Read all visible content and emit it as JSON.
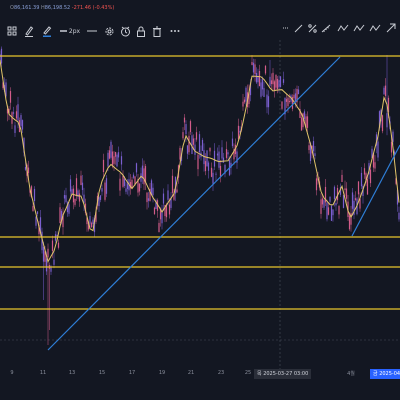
{
  "header": {
    "ohlc_open_label": "O",
    "ohlc_open_value": "86,161.39",
    "ohlc_high_label": "H",
    "ohlc_high_value": "86,198.52",
    "ohlc_change": "-271.46 (-0.43%)"
  },
  "toolbar": {
    "line_width_label": "2px",
    "left_icons": [
      "template-icon",
      "pencil-icon",
      "line-color-icon",
      "line-width-icon",
      "line-style-icon",
      "settings-icon",
      "alert-icon",
      "lock-icon",
      "trash-icon",
      "more-icon"
    ],
    "right_icons": [
      "dashed-line-icon",
      "trend-line-icon",
      "percent-icon",
      "ruler-icon",
      "wave-a-icon",
      "wave-b-icon",
      "wave-c-icon",
      "arrow-up-right-icon"
    ]
  },
  "time_axis": {
    "ticks": [
      "9",
      "11",
      "13",
      "15",
      "17",
      "19",
      "21",
      "23",
      "25",
      "4월"
    ],
    "crosshair_date": "목 2025-03-27  03:00",
    "highlight_date": "금 2025-04"
  },
  "colors": {
    "background": "#131722",
    "horizontal_lines": "#e8c62c",
    "trend_lines": "#2f7fd8",
    "moving_average": "#e2c56a",
    "candles": "#7b5fd0",
    "candles_alt": "#d35c8a"
  }
}
